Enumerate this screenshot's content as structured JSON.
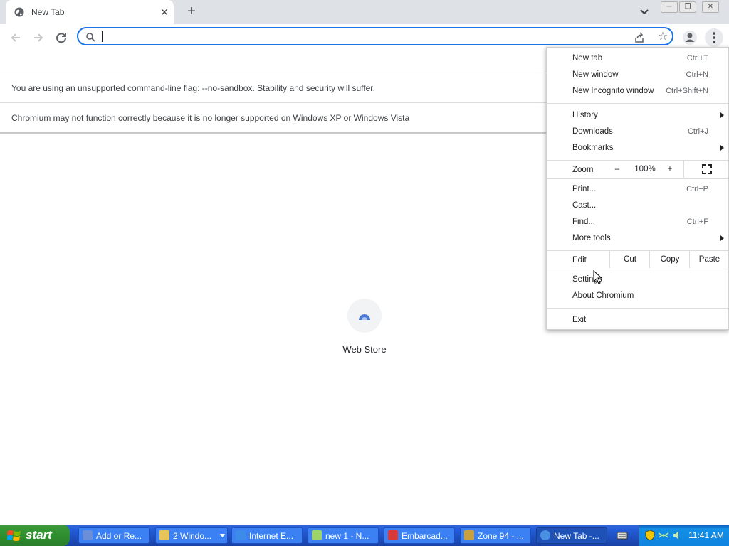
{
  "browser": {
    "tab_title": "New Tab",
    "tab_close_glyph": "✕",
    "new_tab_glyph": "+",
    "window_buttons": {
      "minimize": "─",
      "restore": "❐",
      "close": "✕"
    },
    "omnibox": {
      "value": "",
      "placeholder": ""
    }
  },
  "infobars": [
    {
      "text": "You are using an unsupported command-line flag: --no-sandbox. Stability and security will suffer."
    },
    {
      "text": "Chromium may not function correctly because it is no longer supported on Windows XP or Windows Vista"
    }
  ],
  "new_tab_page": {
    "shortcut_label": "Web Store"
  },
  "menu": {
    "new_tab": {
      "label": "New tab",
      "shortcut": "Ctrl+T"
    },
    "new_window": {
      "label": "New window",
      "shortcut": "Ctrl+N"
    },
    "new_incognito": {
      "label": "New Incognito window",
      "shortcut": "Ctrl+Shift+N"
    },
    "history": {
      "label": "History"
    },
    "downloads": {
      "label": "Downloads",
      "shortcut": "Ctrl+J"
    },
    "bookmarks": {
      "label": "Bookmarks"
    },
    "zoom": {
      "label": "Zoom",
      "minus": "–",
      "value": "100%",
      "plus": "+"
    },
    "print": {
      "label": "Print...",
      "shortcut": "Ctrl+P"
    },
    "cast": {
      "label": "Cast..."
    },
    "find": {
      "label": "Find...",
      "shortcut": "Ctrl+F"
    },
    "more_tools": {
      "label": "More tools"
    },
    "edit": {
      "label": "Edit",
      "cut": "Cut",
      "copy": "Copy",
      "paste": "Paste"
    },
    "settings": {
      "label": "Settings"
    },
    "about": {
      "label": "About Chromium"
    },
    "exit": {
      "label": "Exit"
    }
  },
  "taskbar": {
    "start_label": "start",
    "items": [
      {
        "label": "Add or Re...",
        "icon_color": "#6a8fd8"
      },
      {
        "label": "2 Windo...",
        "icon_color": "#e8c35a"
      },
      {
        "label": "Internet E...",
        "icon_color": "#3d8be8"
      },
      {
        "label": "new 1 - N...",
        "icon_color": "#9ed36a"
      },
      {
        "label": "Embarcad...",
        "icon_color": "#d83a3a"
      },
      {
        "label": "Zone 94 - ...",
        "icon_color": "#c8a040"
      },
      {
        "label": "New Tab -...",
        "icon_color": "#4a90e2"
      }
    ],
    "clock": "11:41 AM"
  },
  "colors": {
    "accent": "#1a73e8",
    "taskbar": "#245edb",
    "start": "#2f8f2f"
  }
}
